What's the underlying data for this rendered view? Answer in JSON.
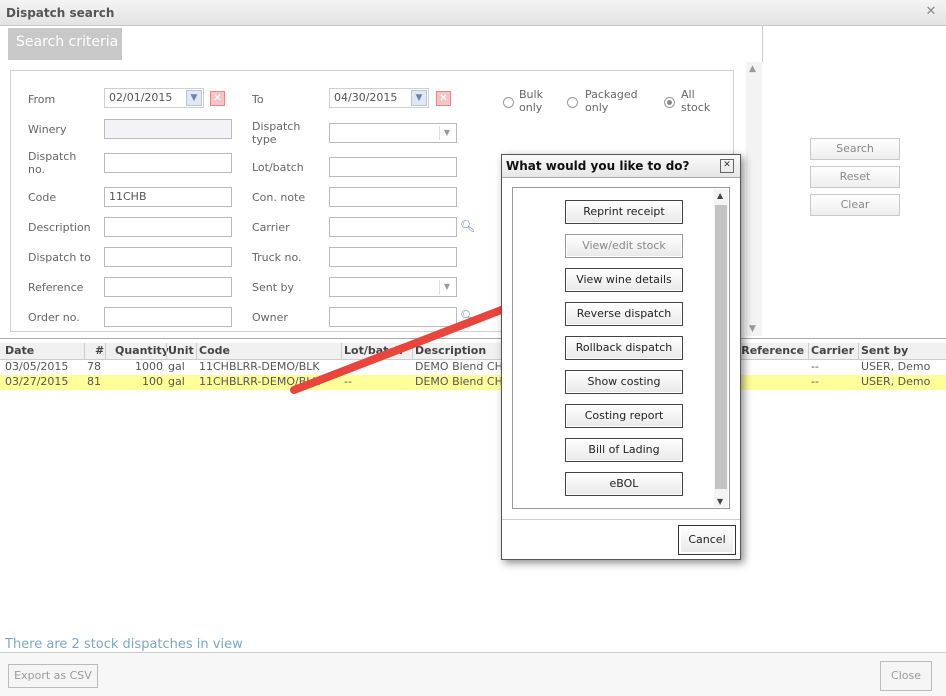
{
  "window": {
    "title": "Dispatch search",
    "close_glyph": "✕"
  },
  "tabs": [
    {
      "label": "Search criteria"
    }
  ],
  "criteria": {
    "from_label": "From",
    "from_value": "02/01/2015",
    "to_label": "To",
    "to_value": "04/30/2015",
    "bulk_only": "Bulk\nonly",
    "packaged_only": "Packaged\nonly",
    "all_stock": "All\nstock",
    "winery_label": "Winery",
    "winery_value": "",
    "dispatch_type_label": "Dispatch\ntype",
    "dispatch_no_label": "Dispatch\nno.",
    "dispatch_no_value": "",
    "lot_batch_label": "Lot/batch",
    "code_label": "Code",
    "code_value": "11CHB",
    "con_note_label": "Con. note",
    "description_label": "Description",
    "carrier_label": "Carrier",
    "dispatch_to_label": "Dispatch to",
    "truck_no_label": "Truck no.",
    "reference_label": "Reference",
    "sent_by_label": "Sent by",
    "order_no_label": "Order no.",
    "owner_label": "Owner"
  },
  "actions": {
    "search": "Search",
    "reset": "Reset",
    "clear": "Clear"
  },
  "grid": {
    "columns": [
      "Date",
      "#",
      "Quantity",
      "Unit",
      "Code",
      "Lot/batch",
      "Description",
      "Reference#",
      "Carrier",
      "Sent by"
    ],
    "rows": [
      {
        "date": "03/05/2015",
        "num": "78",
        "qty": "1000",
        "unit": "gal",
        "code": "11CHBLRR-DEMO/BLK",
        "lot": "",
        "desc": "DEMO Blend CH",
        "carrier": "--",
        "sent_by": "USER, Demo"
      },
      {
        "date": "03/27/2015",
        "num": "81",
        "qty": "100",
        "unit": "gal",
        "code": "11CHBLRR-DEMO/BLK",
        "lot": "--",
        "desc": "DEMO Blend CH",
        "carrier": "--",
        "sent_by": "USER, Demo"
      }
    ]
  },
  "status_text": "There are 2 stock dispatches in view",
  "bottom": {
    "export": "Export as CSV",
    "close": "Close"
  },
  "dialog": {
    "title": "What would you like to do?",
    "buttons": [
      "Reprint receipt",
      "View/edit stock",
      "View wine details",
      "Reverse dispatch",
      "Rollback dispatch",
      "Show costing",
      "Costing report",
      "Bill of Lading",
      "eBOL"
    ],
    "cancel": "Cancel"
  },
  "colors": {
    "accent": "#7da6c6",
    "selected_row": "#ffff99",
    "arrow": "#e8453c"
  }
}
